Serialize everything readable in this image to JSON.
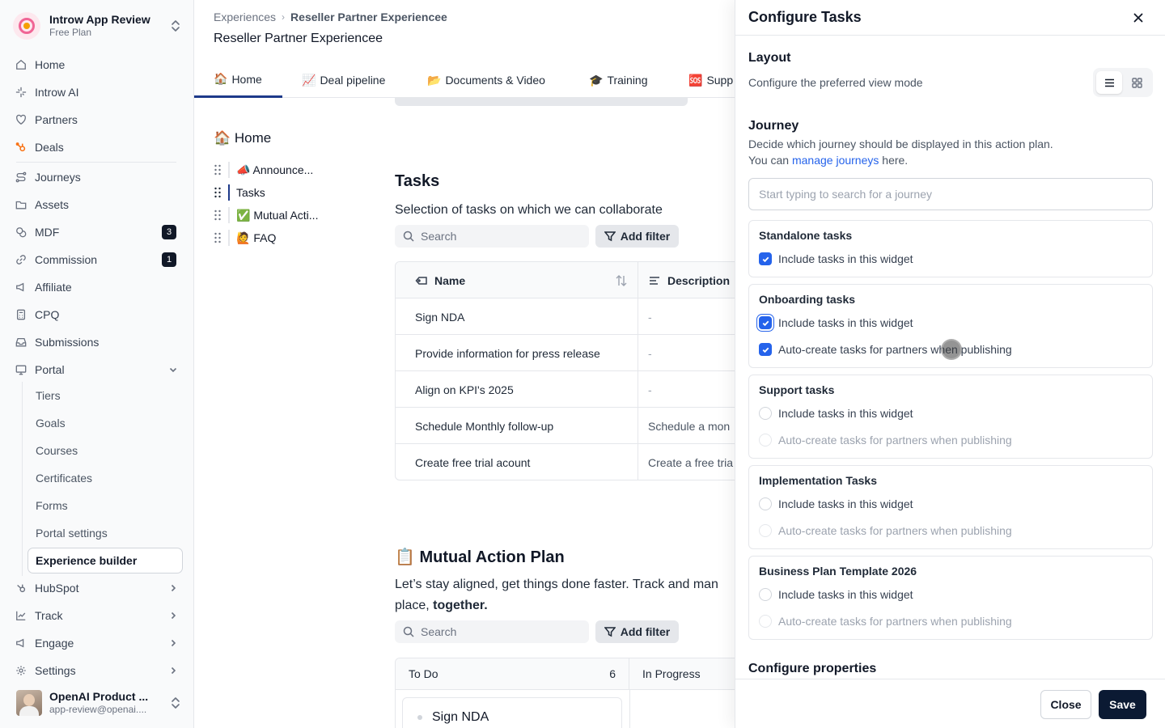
{
  "workspace": {
    "name": "Introw App Review",
    "plan": "Free Plan"
  },
  "nav": {
    "home": "Home",
    "ai": "Introw AI",
    "partners": "Partners",
    "deals": "Deals",
    "journeys": "Journeys",
    "assets": "Assets",
    "mdf": "MDF",
    "mdf_count": "3",
    "commission": "Commission",
    "commission_count": "1",
    "affiliate": "Affiliate",
    "cpq": "CPQ",
    "submissions": "Submissions",
    "portal": "Portal",
    "portal_sub": [
      "Tiers",
      "Goals",
      "Courses",
      "Certificates",
      "Forms",
      "Portal settings"
    ],
    "experience_builder": "Experience builder",
    "hubspot": "HubSpot",
    "track": "Track",
    "engage": "Engage",
    "settings": "Settings"
  },
  "user": {
    "name": "OpenAI Product ...",
    "email": "app-review@openai...."
  },
  "breadcrumb": {
    "root": "Experiences",
    "current": "Reseller Partner Experiencee"
  },
  "page_title": "Reseller Partner Experiencee",
  "tabs": [
    {
      "emoji": "🏠",
      "label": "Home"
    },
    {
      "emoji": "📈",
      "label": "Deal pipeline"
    },
    {
      "emoji": "📂",
      "label": "Documents & Video"
    },
    {
      "emoji": "🎓",
      "label": "Training"
    },
    {
      "emoji": "🆘",
      "label": "Supp"
    }
  ],
  "tree": {
    "title": "🏠 Home",
    "items": [
      "📣 Announce...",
      "Tasks",
      "✅ Mutual Acti...",
      "🙋 FAQ"
    ]
  },
  "tasks": {
    "title": "Tasks",
    "description": "Selection of tasks on which we can collaborate",
    "search_placeholder": "Search",
    "filter_label": "Add filter",
    "col_name": "Name",
    "col_desc": "Description",
    "rows": [
      {
        "name": "Sign NDA",
        "desc": "-"
      },
      {
        "name": "Provide information for press release",
        "desc": "-"
      },
      {
        "name": "Align on KPI's 2025",
        "desc": "-"
      },
      {
        "name": "Schedule Monthly follow-up",
        "desc": "Schedule a mon"
      },
      {
        "name": "Create free trial acount",
        "desc": "Create a free tria"
      }
    ]
  },
  "map": {
    "title": "📋 Mutual Action Plan",
    "desc_line1": "Let’s stay aligned, get things done faster. Track and man",
    "desc_line2_pre": "place, ",
    "desc_line2_bold": "together.",
    "search_placeholder": "Search",
    "filter_label": "Add filter",
    "col_todo": "To Do",
    "col_todo_count": "6",
    "col_progress": "In Progress",
    "card": "Sign NDA"
  },
  "panel": {
    "title": "Configure Tasks",
    "layout_title": "Layout",
    "layout_desc": "Configure the preferred view mode",
    "journey_title": "Journey",
    "journey_desc": "Decide which journey should be displayed in this action plan.",
    "journey_link_pre": "You can ",
    "journey_link": "manage journeys",
    "journey_link_post": " here.",
    "journey_placeholder": "Start typing to search for a journey",
    "include_label": "Include tasks in this widget",
    "autocreate_label": "Auto-create tasks for partners when publishing",
    "cards": [
      {
        "title": "Standalone tasks"
      },
      {
        "title": "Onboarding tasks"
      },
      {
        "title": "Support tasks"
      },
      {
        "title": "Implementation Tasks"
      },
      {
        "title": "Business Plan Template 2026"
      }
    ],
    "configure_properties": "Configure properties",
    "close_btn": "Close",
    "save_btn": "Save"
  }
}
